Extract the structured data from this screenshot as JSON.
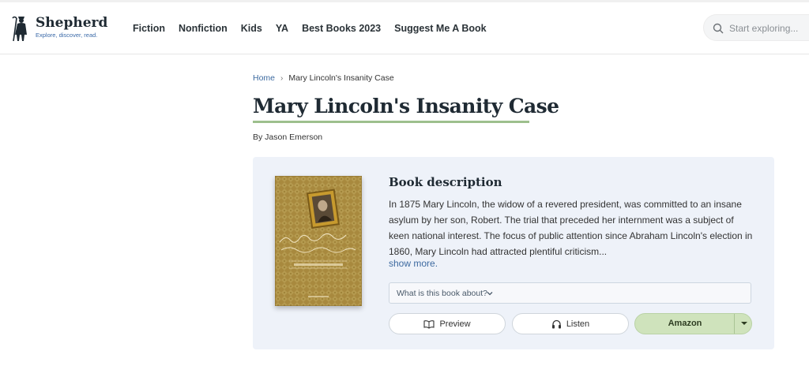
{
  "brand": {
    "name": "Shepherd",
    "tagline": "Explore, discover, read."
  },
  "nav": {
    "items": [
      {
        "label": "Fiction"
      },
      {
        "label": "Nonfiction"
      },
      {
        "label": "Kids"
      },
      {
        "label": "YA"
      },
      {
        "label": "Best Books 2023"
      },
      {
        "label": "Suggest Me A Book"
      }
    ]
  },
  "search": {
    "placeholder": "Start exploring...",
    "icon": "search-icon"
  },
  "breadcrumb": {
    "home": "Home",
    "separator": "›",
    "current": "Mary Lincoln's Insanity Case"
  },
  "book": {
    "title": "Mary Lincoln's Insanity Case",
    "byline": "By Jason Emerson",
    "description_heading": "Book description",
    "description": "In 1875 Mary Lincoln, the widow of a revered president, was committed to an insane asylum by her son, Robert. The trial that preceded her internment was a subject of keen national interest. The focus of public attention since Abraham Lincoln's election in 1860, Mary Lincoln had attracted plentiful criticism...",
    "show_more": "show more.",
    "about_label": "What is this book about?",
    "cover_script_title": "Mary Lincoln's Insanity Case",
    "cover_subtitle": "A DOCUMENTARY HISTORY"
  },
  "actions": {
    "preview": "Preview",
    "listen": "Listen",
    "amazon": "Amazon"
  },
  "colors": {
    "accent_underline": "#9dbf8d",
    "amazon_button": "#cfe3bc",
    "card_background": "#eef2f9",
    "link": "#3d6aa0"
  }
}
